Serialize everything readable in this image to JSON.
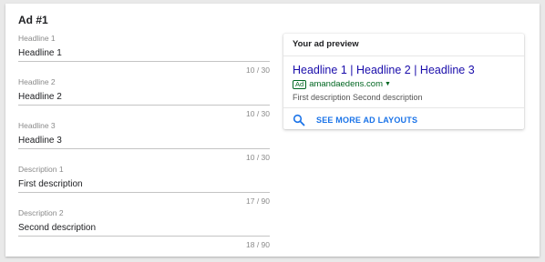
{
  "ad": {
    "title": "Ad #1"
  },
  "fields": [
    {
      "label": "Headline 1",
      "value": "Headline 1",
      "counter": "10 / 30"
    },
    {
      "label": "Headline 2",
      "value": "Headline 2",
      "counter": "10 / 30"
    },
    {
      "label": "Headline 3",
      "value": "Headline 3",
      "counter": "10 / 30"
    },
    {
      "label": "Description 1",
      "value": "First description",
      "counter": "17 / 90"
    },
    {
      "label": "Description 2",
      "value": "Second description",
      "counter": "18 / 90"
    }
  ],
  "preview": {
    "header": "Your ad preview",
    "headline": "Headline 1 | Headline 2 | Headline 3",
    "badge": "Ad",
    "url": "amandaedens.com",
    "description": "First description Second description",
    "see_more_label": "SEE MORE AD LAYOUTS",
    "search_icon": "search-icon"
  },
  "colors": {
    "headline_link": "#1a0dab",
    "url_green": "#006621",
    "action_blue": "#1a73e8"
  }
}
